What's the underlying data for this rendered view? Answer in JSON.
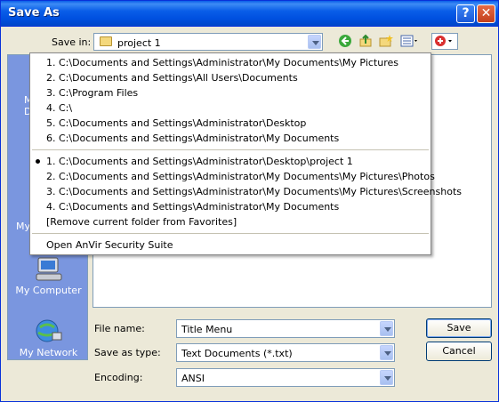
{
  "window": {
    "title": "Save As"
  },
  "toolbar": {
    "save_in_label": "Save in:",
    "save_in_value": "project 1"
  },
  "menu": {
    "recent": [
      "1. C:\\Documents and Settings\\Administrator\\My Documents\\My Pictures",
      "2. C:\\Documents and Settings\\All Users\\Documents",
      "3. C:\\Program Files",
      "4. C:\\",
      "5. C:\\Documents and Settings\\Administrator\\Desktop",
      "6. C:\\Documents and Settings\\Administrator\\My Documents"
    ],
    "favorites": [
      "1. C:\\Documents and Settings\\Administrator\\Desktop\\project 1",
      "2. C:\\Documents and Settings\\Administrator\\My Documents\\My Pictures\\Photos",
      "3. C:\\Documents and Settings\\Administrator\\My Documents\\My Pictures\\Screenshots",
      "4. C:\\Documents and Settings\\Administrator\\My Documents"
    ],
    "remove_favorite": "[Remove current folder from Favorites]",
    "anvir": "Open AnVir Security Suite"
  },
  "places": {
    "my_documents_partial_1": "M",
    "my_documents_partial_2": "D",
    "my_network_partial": "My",
    "my_computer": "My Computer",
    "my_network": "My Network"
  },
  "form": {
    "file_name_label": "File name:",
    "file_name_value": "Title Menu",
    "save_as_type_label": "Save as type:",
    "save_as_type_value": "Text Documents (*.txt)",
    "encoding_label": "Encoding:",
    "encoding_value": "ANSI"
  },
  "buttons": {
    "save": "Save",
    "cancel": "Cancel"
  },
  "colors": {
    "title_bar": "#0a5ee8",
    "places_bar": "#7a96df",
    "dialog_bg": "#ece9d8"
  }
}
